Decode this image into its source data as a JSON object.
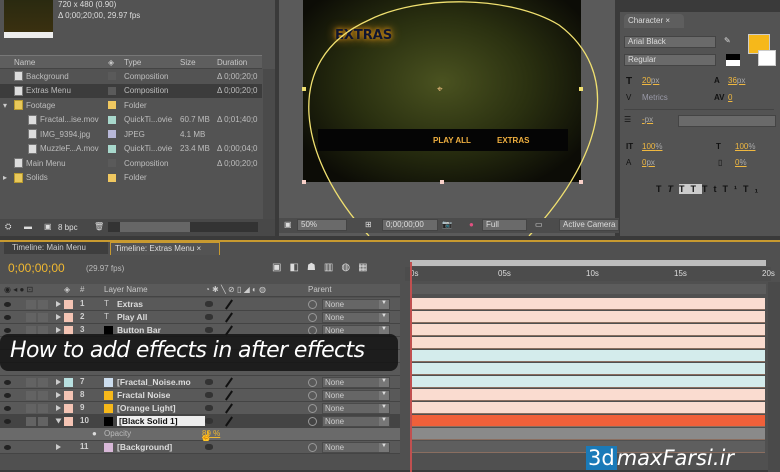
{
  "project": {
    "comp_info": [
      "720 x 480 (0.90)",
      "Δ 0;00;20;00, 29.97 fps"
    ],
    "columns": [
      "Name",
      "Type",
      "Size",
      "Duration"
    ],
    "items": [
      {
        "name": "Background",
        "type": "Composition",
        "size": "",
        "duration": "Δ 0;00;20;0",
        "kind": "comp",
        "label": "#5a5a5a",
        "indent": 0
      },
      {
        "name": "Extras Menu",
        "type": "Composition",
        "size": "",
        "duration": "Δ 0;00;20;0",
        "kind": "comp",
        "label": "#5a5a5a",
        "indent": 0,
        "selected": true
      },
      {
        "name": "Footage",
        "type": "Folder",
        "size": "",
        "duration": "",
        "kind": "folder",
        "label": "#f0c860",
        "indent": 0
      },
      {
        "name": "Fractal...ise.mov",
        "type": "QuickTi...ovie",
        "size": "60.7 MB",
        "duration": "Δ 0;01;40;0",
        "kind": "movie",
        "label": "#a8d8cc",
        "indent": 1
      },
      {
        "name": "IMG_9394.jpg",
        "type": "JPEG",
        "size": "4.1 MB",
        "duration": "",
        "kind": "image",
        "label": "#b8b8d8",
        "indent": 1
      },
      {
        "name": "MuzzleF...A.mov",
        "type": "QuickTi...ovie",
        "size": "23.4 MB",
        "duration": "Δ 0;00;04;0",
        "kind": "movie",
        "label": "#a8d8cc",
        "indent": 1
      },
      {
        "name": "Main Menu",
        "type": "Composition",
        "size": "",
        "duration": "Δ 0;00;20;0",
        "kind": "comp",
        "label": "#5a5a5a",
        "indent": 0
      },
      {
        "name": "Solids",
        "type": "Folder",
        "size": "",
        "duration": "",
        "kind": "folder",
        "label": "#f0c860",
        "indent": 0
      }
    ],
    "bpc": "8 bpc"
  },
  "viewer": {
    "title_text": "EXTRAS",
    "menu": [
      "PLAY ALL",
      "EXTRAS"
    ],
    "zoom": "50%",
    "timecode": "0;00;00;00",
    "resolution": "Full",
    "camera": "Active Camera"
  },
  "character": {
    "tab": "Character",
    "font": "Arial Black",
    "style": "Regular",
    "size": "20",
    "leading": "36",
    "kerning": "Metrics",
    "tracking": "0",
    "stroke": "-",
    "vscale": "100",
    "hscale": "100",
    "baseline": "0",
    "tsume": "0",
    "unit_px": "px",
    "unit_pct": "%",
    "fill_color": "#f6b81a"
  },
  "timeline": {
    "tabs": [
      "Timeline: Main Menu",
      "Timeline: Extras Menu"
    ],
    "timecode": "0;00;00;00",
    "fps": "(29.97 fps)",
    "header": {
      "num": "#",
      "name": "Layer Name",
      "parent": "Parent"
    },
    "ruler": [
      "0s",
      "05s",
      "10s",
      "15s",
      "20s"
    ],
    "layers": [
      {
        "num": "1",
        "name": "Extras",
        "src": "text",
        "label": "#f4c4b4",
        "bar": "#fadcd0"
      },
      {
        "num": "2",
        "name": "Play All",
        "src": "text",
        "label": "#f4c4b4",
        "bar": "#fadcd0"
      },
      {
        "num": "3",
        "name": "Button Bar",
        "src": "#000000",
        "label": "#f4c4b4",
        "bar": "#fadcd0"
      },
      {
        "num": "",
        "name": "",
        "src": "",
        "label": "#f4c4b4",
        "bar": "#fadcd0",
        "hidden": true
      },
      {
        "num": "",
        "name": "",
        "src": "",
        "label": "#b8e0e0",
        "bar": "#d4ecec",
        "hidden": true
      },
      {
        "num": "",
        "name": "",
        "src": "",
        "label": "#b8e0e0",
        "bar": "#d4ecec",
        "hidden": true
      },
      {
        "num": "7",
        "name": "[Fractal_Noise.mo",
        "src": "movie",
        "label": "#b8e0e0",
        "bar": "#d4ecec"
      },
      {
        "num": "8",
        "name": "Fractal Noise",
        "src": "#f6b81a",
        "label": "#f4c4b4",
        "bar": "#fadcd0"
      },
      {
        "num": "9",
        "name": "[Orange Light]",
        "src": "#f6b81a",
        "label": "#f4c4b4",
        "bar": "#fadcd0"
      },
      {
        "num": "10",
        "name": "[Black Solid 1]",
        "src": "#000000",
        "label": "#f4c4b4",
        "bar": "#f0603a",
        "selected": true
      }
    ],
    "property": {
      "name": "Opacity",
      "value": "89 %"
    },
    "last_layer": {
      "num": "11",
      "name": "[Background]",
      "parent": "None"
    },
    "parent_value": "None"
  },
  "overlay": {
    "caption": "How to add effects in after effects"
  },
  "watermark": {
    "brand_a": "3d",
    "brand_b": "maxFarsi.ir"
  }
}
